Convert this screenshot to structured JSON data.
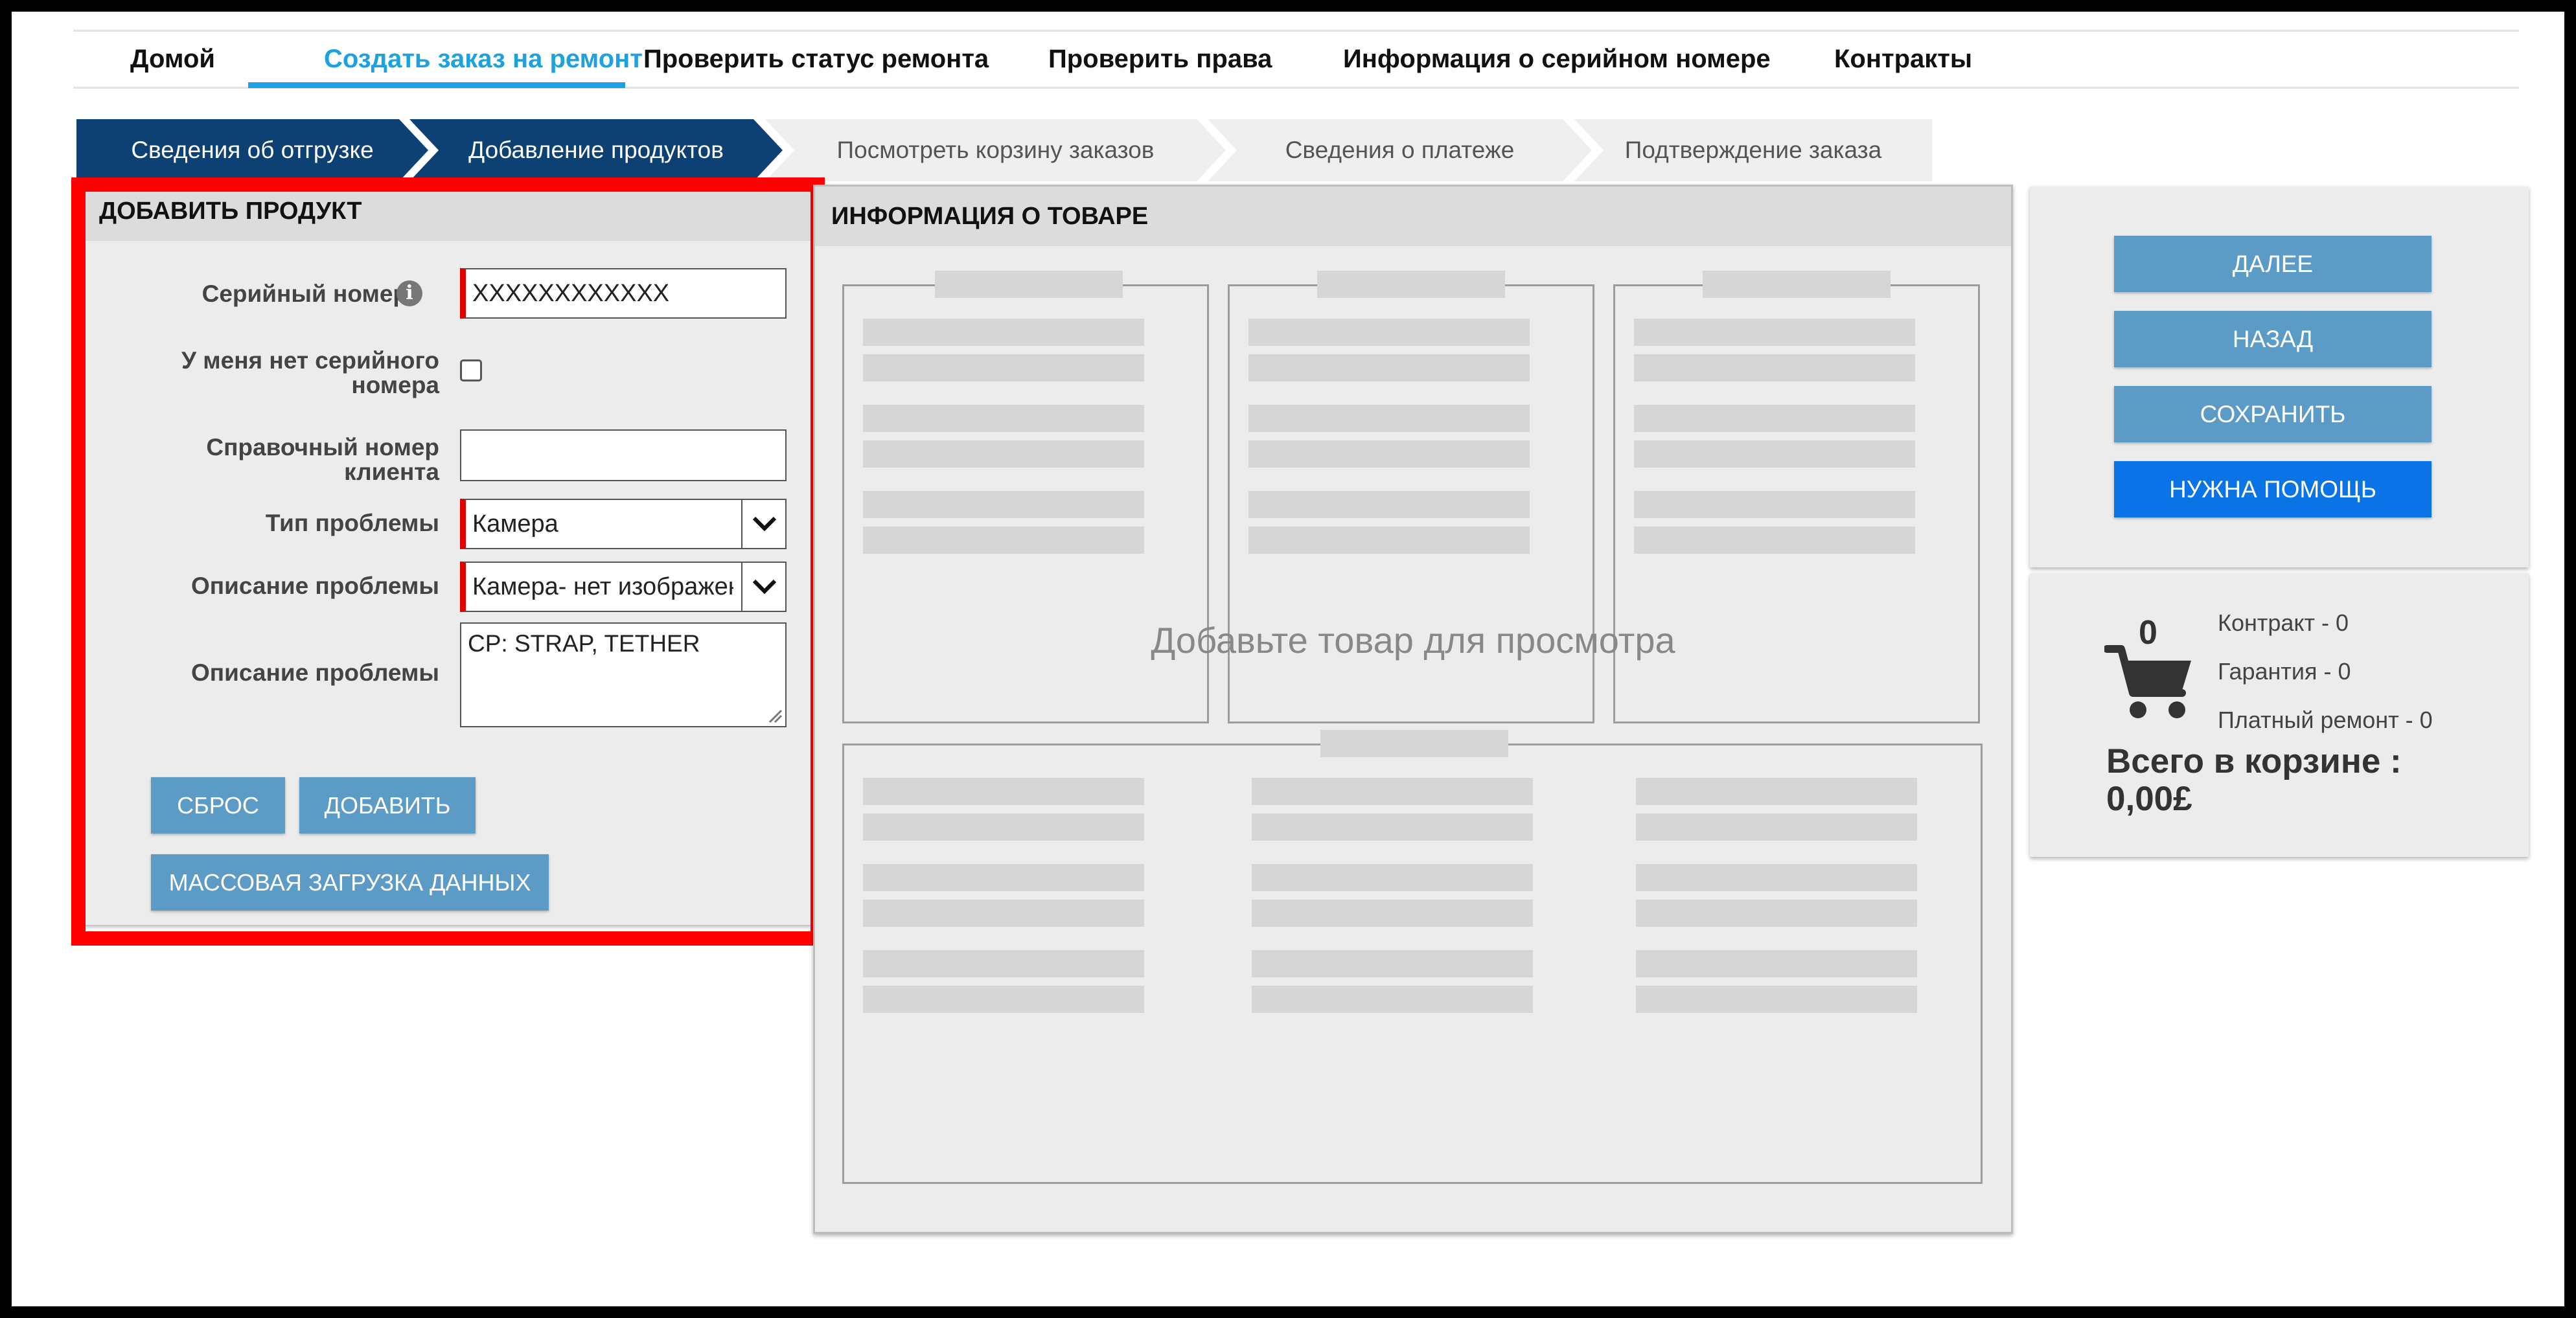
{
  "nav": {
    "items": [
      {
        "label": "Домой",
        "active": false
      },
      {
        "label": "Создать заказ на ремонт",
        "active": true
      },
      {
        "label": "Проверить статус ремонта",
        "active": false
      },
      {
        "label": "Проверить права",
        "active": false
      },
      {
        "label": "Информация о серийном номере",
        "active": false
      },
      {
        "label": "Контракты",
        "active": false
      }
    ]
  },
  "steps": [
    {
      "label": "Сведения об отгрузке",
      "state": "done"
    },
    {
      "label": "Добавление продуктов",
      "state": "current"
    },
    {
      "label": "Посмотреть корзину заказов",
      "state": "todo"
    },
    {
      "label": "Сведения о платеже",
      "state": "todo"
    },
    {
      "label": "Подтверждение заказа",
      "state": "todo"
    }
  ],
  "add_product": {
    "title": "ДОБАВИТЬ ПРОДУКТ",
    "serial_label": "Серийный номер",
    "serial_value": "XXXXXXXXXXXX",
    "no_serial_label_line1": "У меня нет серийного",
    "no_serial_label_line2": "номера",
    "no_serial_checked": false,
    "customer_ref_label_line1": "Справочный номер",
    "customer_ref_label_line2": "клиента",
    "customer_ref_value": "",
    "problem_type_label": "Тип проблемы",
    "problem_type_value": "Камера",
    "problem_desc_label": "Описание проблемы",
    "problem_desc_value": "Камера- нет изображения",
    "problem_desc2_label": "Описание проблемы",
    "problem_desc2_value": "CP: STRAP, TETHER",
    "reset_button": "СБРОС",
    "add_button": "ДОБАВИТЬ",
    "bulk_button": "МАССОВАЯ ЗАГРУЗКА ДАННЫХ"
  },
  "product_info": {
    "title": "ИНФОРМАЦИЯ О ТОВАРЕ",
    "placeholder": "Добавьте товар для просмотра"
  },
  "actions": {
    "next": "ДАЛЕЕ",
    "back": "НАЗАД",
    "save": "СОХРАНИТЬ",
    "help": "НУЖНА ПОМОЩЬ"
  },
  "cart": {
    "count": "0",
    "contract": "Контракт - 0",
    "warranty": "Гарантия - 0",
    "paid": "Платный ремонт - 0",
    "total_line1": "Всего в корзине :",
    "total_line2": "0,00£"
  },
  "colors": {
    "accent": "#1ca2e1",
    "step_done": "#0d4073",
    "button": "#5b9bc6",
    "help_button": "#0a73e6",
    "required": "#e00000",
    "highlight_frame": "#ff0000"
  }
}
